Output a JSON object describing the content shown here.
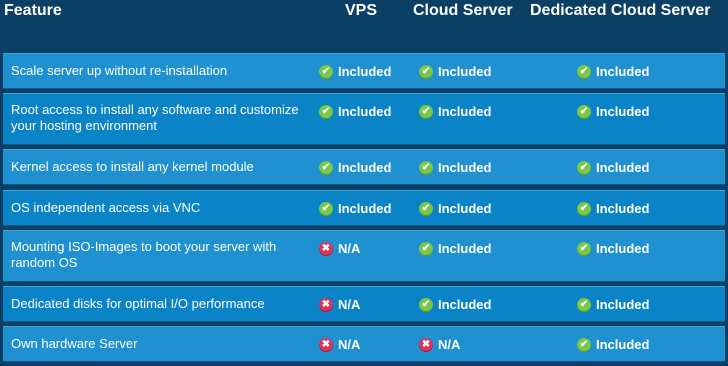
{
  "header": {
    "feature": "Feature",
    "vps": "VPS",
    "cloud": "Cloud Server",
    "dedicated": "Dedicated Cloud Server"
  },
  "rows": [
    {
      "feature": "Scale server up without re-installation",
      "vps": "Included",
      "cloud": "Included",
      "dedicated": "Included"
    },
    {
      "feature": "Root access to install any software and customize your hosting environment",
      "vps": "Included",
      "cloud": "Included",
      "dedicated": "Included"
    },
    {
      "feature": "Kernel access to install any kernel module",
      "vps": "Included",
      "cloud": "Included",
      "dedicated": "Included"
    },
    {
      "feature": "OS independent access via VNC",
      "vps": "Included",
      "cloud": "Included",
      "dedicated": "Included"
    },
    {
      "feature": "Mounting ISO-Images to boot your server with random OS",
      "vps": "N/A",
      "cloud": "Included",
      "dedicated": "Included"
    },
    {
      "feature": "Dedicated disks for optimal I/O performance",
      "vps": "N/A",
      "cloud": "Included",
      "dedicated": "Included"
    },
    {
      "feature": "Own hardware Server",
      "vps": "N/A",
      "cloud": "N/A",
      "dedicated": "Included"
    }
  ],
  "icons": {
    "included": "check-circle-icon",
    "na": "x-circle-icon"
  },
  "colors": {
    "background": "#0b3f63",
    "row": "#1f90d0",
    "row_alt": "#0b84c7",
    "included": "#79c84a",
    "na": "#d7345e"
  }
}
